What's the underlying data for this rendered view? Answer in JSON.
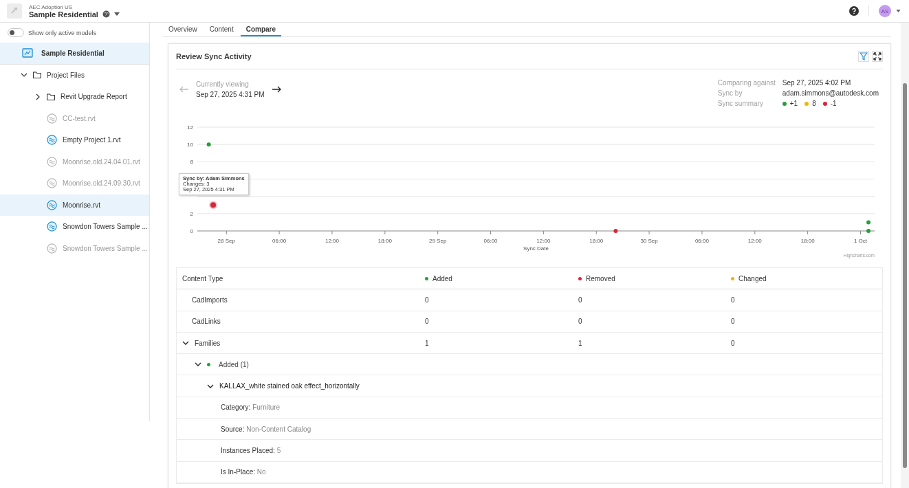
{
  "header": {
    "account": "AEC Adoption US",
    "project": "Sample Residential",
    "avatar": "AS"
  },
  "sidebar": {
    "toggle": {
      "label": "Show only active models",
      "on": false
    },
    "items": [
      {
        "kind": "project",
        "label": "Sample Residential",
        "selected": true,
        "children": [
          {
            "kind": "folder",
            "label": "Project Files",
            "selected": false,
            "expanded": true,
            "children": [
              {
                "kind": "folder",
                "label": "Revit Upgrade Report",
                "selected": false,
                "expanded": false
              },
              {
                "kind": "file",
                "label": "CC-test.rvt",
                "selected": false,
                "active": false
              },
              {
                "kind": "file",
                "label": "Empty Project 1.rvt",
                "selected": false,
                "active": true
              },
              {
                "kind": "file",
                "label": "Moonrise.old.24.04.01.rvt",
                "selected": false,
                "active": false
              },
              {
                "kind": "file",
                "label": "Moonrise.old.24.09.30.rvt",
                "selected": false,
                "active": false
              },
              {
                "kind": "file",
                "label": "Moonrise.rvt",
                "selected": true,
                "active": true
              },
              {
                "kind": "file",
                "label": "Snowdon Towers Sample ...",
                "selected": false,
                "active": true
              },
              {
                "kind": "file",
                "label": "Snowdon Towers Sample ...",
                "selected": false,
                "active": false
              }
            ]
          }
        ]
      }
    ]
  },
  "tabs": [
    {
      "label": "Overview",
      "selected": false
    },
    {
      "label": "Content",
      "selected": false
    },
    {
      "label": "Compare",
      "selected": true
    }
  ],
  "panel": {
    "title": "Review Sync Activity",
    "viewing": {
      "label": "Currently viewing",
      "date": "Sep 27, 2025 4:31 PM",
      "prev_disabled": true,
      "next_disabled": false
    },
    "details": [
      {
        "label": "Comparing against",
        "value": "Sep 27, 2025 4:02 PM"
      },
      {
        "label": "Sync by",
        "value": "adam.simmons@autodesk.com"
      }
    ],
    "summary": {
      "label": "Sync summary",
      "items": [
        {
          "text": "+1",
          "color": "#2a9d3a"
        },
        {
          "text": "8",
          "color": "#f5b400"
        },
        {
          "text": "-1",
          "color": "#d8263a"
        }
      ]
    },
    "chart_data": {
      "type": "scatter",
      "xlabel": "Sync Date",
      "grid": true,
      "xlim": [
        "2025-09-27T20:42",
        "2025-10-01T01:36"
      ],
      "ylim": [
        0,
        12
      ],
      "yticks": [
        0,
        2,
        8,
        10,
        12
      ],
      "xticks": [
        {
          "value": "2025-09-28T00:00",
          "label": "28 Sep"
        },
        {
          "value": "2025-09-28T06:00",
          "label": "06:00"
        },
        {
          "value": "2025-09-28T12:00",
          "label": "12:00"
        },
        {
          "value": "2025-09-28T18:00",
          "label": "18:00"
        },
        {
          "value": "2025-09-29T00:00",
          "label": "29 Sep"
        },
        {
          "value": "2025-09-29T06:00",
          "label": "06:00"
        },
        {
          "value": "2025-09-29T12:00",
          "label": "12:00"
        },
        {
          "value": "2025-09-29T18:00",
          "label": "18:00"
        },
        {
          "value": "2025-09-30T00:00",
          "label": "30 Sep"
        },
        {
          "value": "2025-09-30T06:00",
          "label": "06:00"
        },
        {
          "value": "2025-09-30T12:00",
          "label": "12:00"
        },
        {
          "value": "2025-09-30T18:00",
          "label": "18:00"
        },
        {
          "value": "2025-10-01T00:00",
          "label": "1 Oct"
        }
      ],
      "series": [
        {
          "color": "#2a9d3a",
          "x": [
            "2025-09-27T22:00",
            "2025-10-01T00:54",
            "2025-10-01T00:54"
          ],
          "values": [
            10,
            1,
            0
          ]
        },
        {
          "color": "#d8263a",
          "x": [
            "2025-09-27T22:30",
            "2025-09-29T20:12"
          ],
          "values": [
            3,
            0
          ]
        }
      ]
    },
    "tooltip": {
      "title": "Sync by: Adam Simmons",
      "lines": [
        "Changes: 3",
        "Sep 27, 2025 4:31 PM"
      ]
    },
    "credit": "Highcharts.com",
    "table": {
      "columns": [
        {
          "label": "Content Type"
        },
        {
          "label": "Added",
          "color": "#2a9d3a"
        },
        {
          "label": "Removed",
          "color": "#d8263a"
        },
        {
          "label": "Changed",
          "color": "#f5b400"
        }
      ],
      "rows": [
        {
          "kind": "category",
          "label": "CadImports",
          "values": [
            "0",
            "0",
            "0"
          ]
        },
        {
          "kind": "category",
          "label": "CadLinks",
          "values": [
            "0",
            "0",
            "0"
          ]
        },
        {
          "kind": "category",
          "label": "Families",
          "values": [
            "1",
            "1",
            "0"
          ],
          "expanded": true,
          "children": [
            {
              "kind": "group",
              "label": "Added (1)",
              "color": "#2a9d3a",
              "expanded": true,
              "children": [
                {
                  "kind": "item",
                  "label": "KALLAX_white stained oak effect_horizontally",
                  "expanded": true,
                  "children": [
                    {
                      "kind": "property",
                      "label": "Category:",
                      "value": "Furniture"
                    },
                    {
                      "kind": "property",
                      "label": "Source:",
                      "value": "Non-Content Catalog"
                    },
                    {
                      "kind": "property",
                      "label": "Instances Placed:",
                      "value": "5"
                    },
                    {
                      "kind": "property",
                      "label": "Is In-Place:",
                      "value": "No"
                    }
                  ]
                }
              ]
            }
          ]
        }
      ]
    }
  }
}
